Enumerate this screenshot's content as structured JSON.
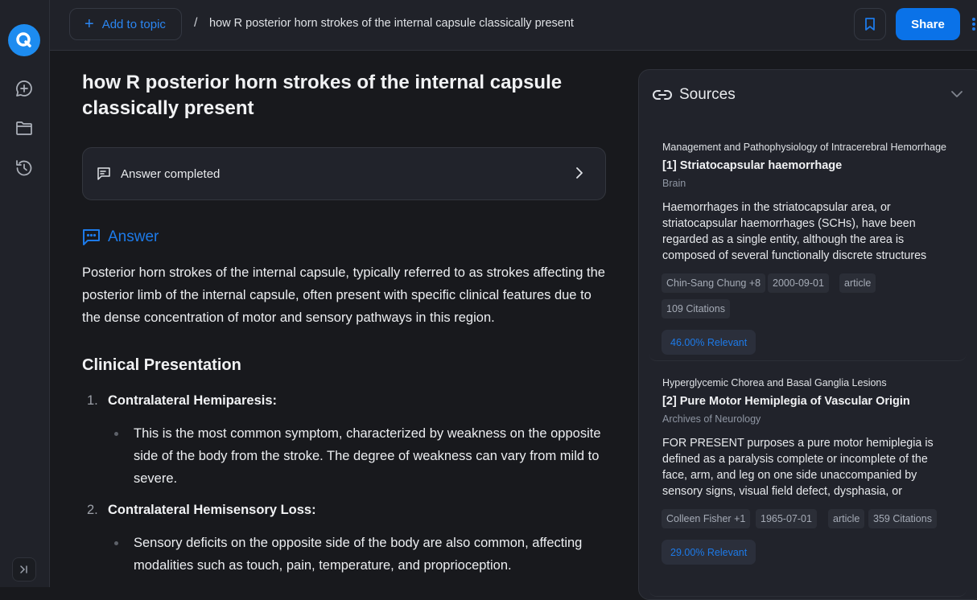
{
  "sidebar": {
    "logo_letter": "Q",
    "items": [
      {
        "name": "new-chat",
        "icon": "chat-plus-icon"
      },
      {
        "name": "folders",
        "icon": "folder-icon"
      },
      {
        "name": "history",
        "icon": "history-icon"
      }
    ],
    "collapse_icon": "expand-sidebar-icon"
  },
  "header": {
    "add_topic_label": "Add to topic",
    "breadcrumb_separator": "/",
    "breadcrumb_title": "how R posterior horn strokes of the internal capsule classically present",
    "share_label": "Share"
  },
  "main": {
    "title": "how R posterior horn strokes of the internal capsule classically present",
    "status_label": "Answer completed",
    "answer_heading": "Answer",
    "intro": "Posterior horn strokes of the internal capsule, typically referred to as strokes affecting the posterior limb of the internal capsule, often present with specific clinical features due to the dense concentration of motor and sensory pathways in this region.",
    "section_heading": "Clinical Presentation",
    "list": [
      {
        "num": "1.",
        "title": "Contralateral Hemiparesis:",
        "text": "This is the most common symptom, characterized by weakness on the opposite side of the body from the stroke. The degree of weakness can vary from mild to severe."
      },
      {
        "num": "2.",
        "title": "Contralateral Hemisensory Loss:",
        "text": "Sensory deficits on the opposite side of the body are also common, affecting modalities such as touch, pain, temperature, and proprioception."
      }
    ]
  },
  "sources": {
    "heading": "Sources",
    "items": [
      {
        "topic": "Management and Pathophysiology of Intracerebral Hemorrhage",
        "title": "[1] Striatocapsular haemorrhage",
        "venue": "Brain",
        "abstract": "Haemorrhages in the striatocapsular area, or striatocapsular haemorrhages (SCHs), have been regarded as a single entity, although the area is composed of several functionally discrete structures",
        "authors": "Chin-Sang Chung +8",
        "date": "2000-09-01",
        "type": "article",
        "citations": "109 Citations",
        "relevance": "46.00% Relevant"
      },
      {
        "topic": "Hyperglycemic Chorea and Basal Ganglia Lesions",
        "title": "[2] Pure Motor Hemiplegia of Vascular Origin",
        "venue": "Archives of Neurology",
        "abstract": "FOR PRESENT purposes a pure motor hemiplegia is defined as a paralysis complete or incomplete of the face, arm, and leg on one side unaccompanied by sensory signs, visual field defect, dysphasia, or",
        "authors": "Colleen Fisher +1",
        "date": "1965-07-01",
        "type": "article",
        "citations": "359 Citations",
        "relevance": "29.00% Relevant"
      }
    ]
  },
  "colors": {
    "accent": "#0a72e8",
    "link_blue": "#1d7ae8",
    "background": "#18191d",
    "panel": "#21232b"
  }
}
